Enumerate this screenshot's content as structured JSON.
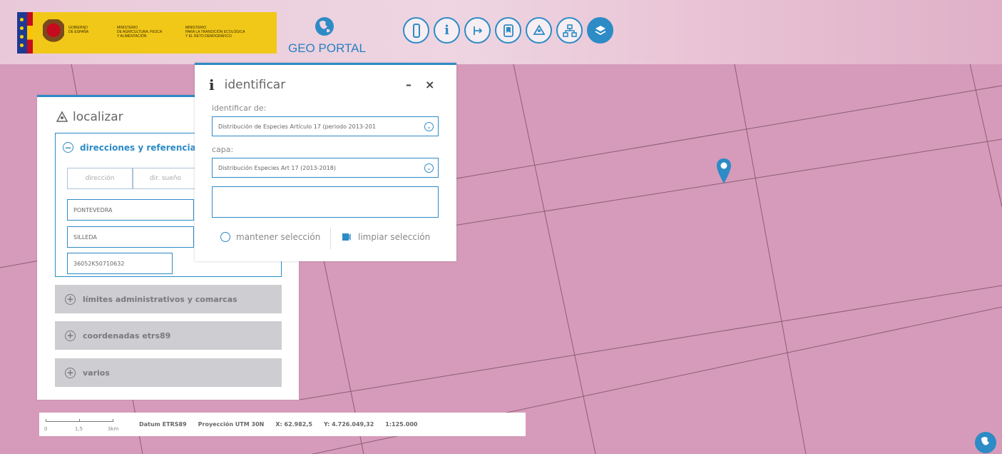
{
  "header": {
    "gov_logo": {
      "col1": "GOBIERNO\nDE ESPAÑA",
      "col2": "MINISTERIO\nDE AGRICULTURA, PESCA\nY ALIMENTACIÓN",
      "col3": "MINISTERIO\nPARA LA TRANSICIÓN ECOLÓGICA\nY EL RETO DEMOGRÁFICO"
    },
    "portal_name": "GEO PORTAL",
    "toolbar": [
      {
        "icon": "ruler-icon"
      },
      {
        "icon": "info-icon"
      },
      {
        "icon": "measure-icon"
      },
      {
        "icon": "bookmark-icon"
      },
      {
        "icon": "locate-icon"
      },
      {
        "icon": "network-icon"
      },
      {
        "icon": "layers-icon"
      }
    ]
  },
  "localizar": {
    "title": "localizar",
    "open_section": {
      "title": "direcciones y referencias c",
      "tabs": [
        "dirección",
        "dir. sueño"
      ],
      "fields": [
        "PONTEVEDRA",
        "SILLEDA",
        "36052K50710632"
      ]
    },
    "closed_sections": [
      "límites administrativos y comarcas",
      "coordenadas etrs89",
      "varios"
    ]
  },
  "identificar": {
    "title": "identificar",
    "minimize": "–",
    "close": "×",
    "identify_from_label": "identificar de:",
    "identify_from_value": "Distribución de Especies Artículo 17 (periodo 2013-201",
    "layer_label": "capa:",
    "layer_value": "Distribución Especies Art 17 (2013-2018)",
    "keep_selection": "mantener selección",
    "clear_selection": "limpiar selección"
  },
  "status_bar": {
    "scale_labels": [
      "0",
      "1,5",
      "3km"
    ],
    "datum": "Datum ETRS89",
    "projection": "Proyección UTM 30N",
    "x": "X: 62.982,5",
    "y": "Y: 4.726.049,32",
    "scale": "1:125.000"
  },
  "colors": {
    "accent": "#2d8bc6",
    "map_fill": "#d69bba",
    "grid_line": "#6d4356"
  }
}
